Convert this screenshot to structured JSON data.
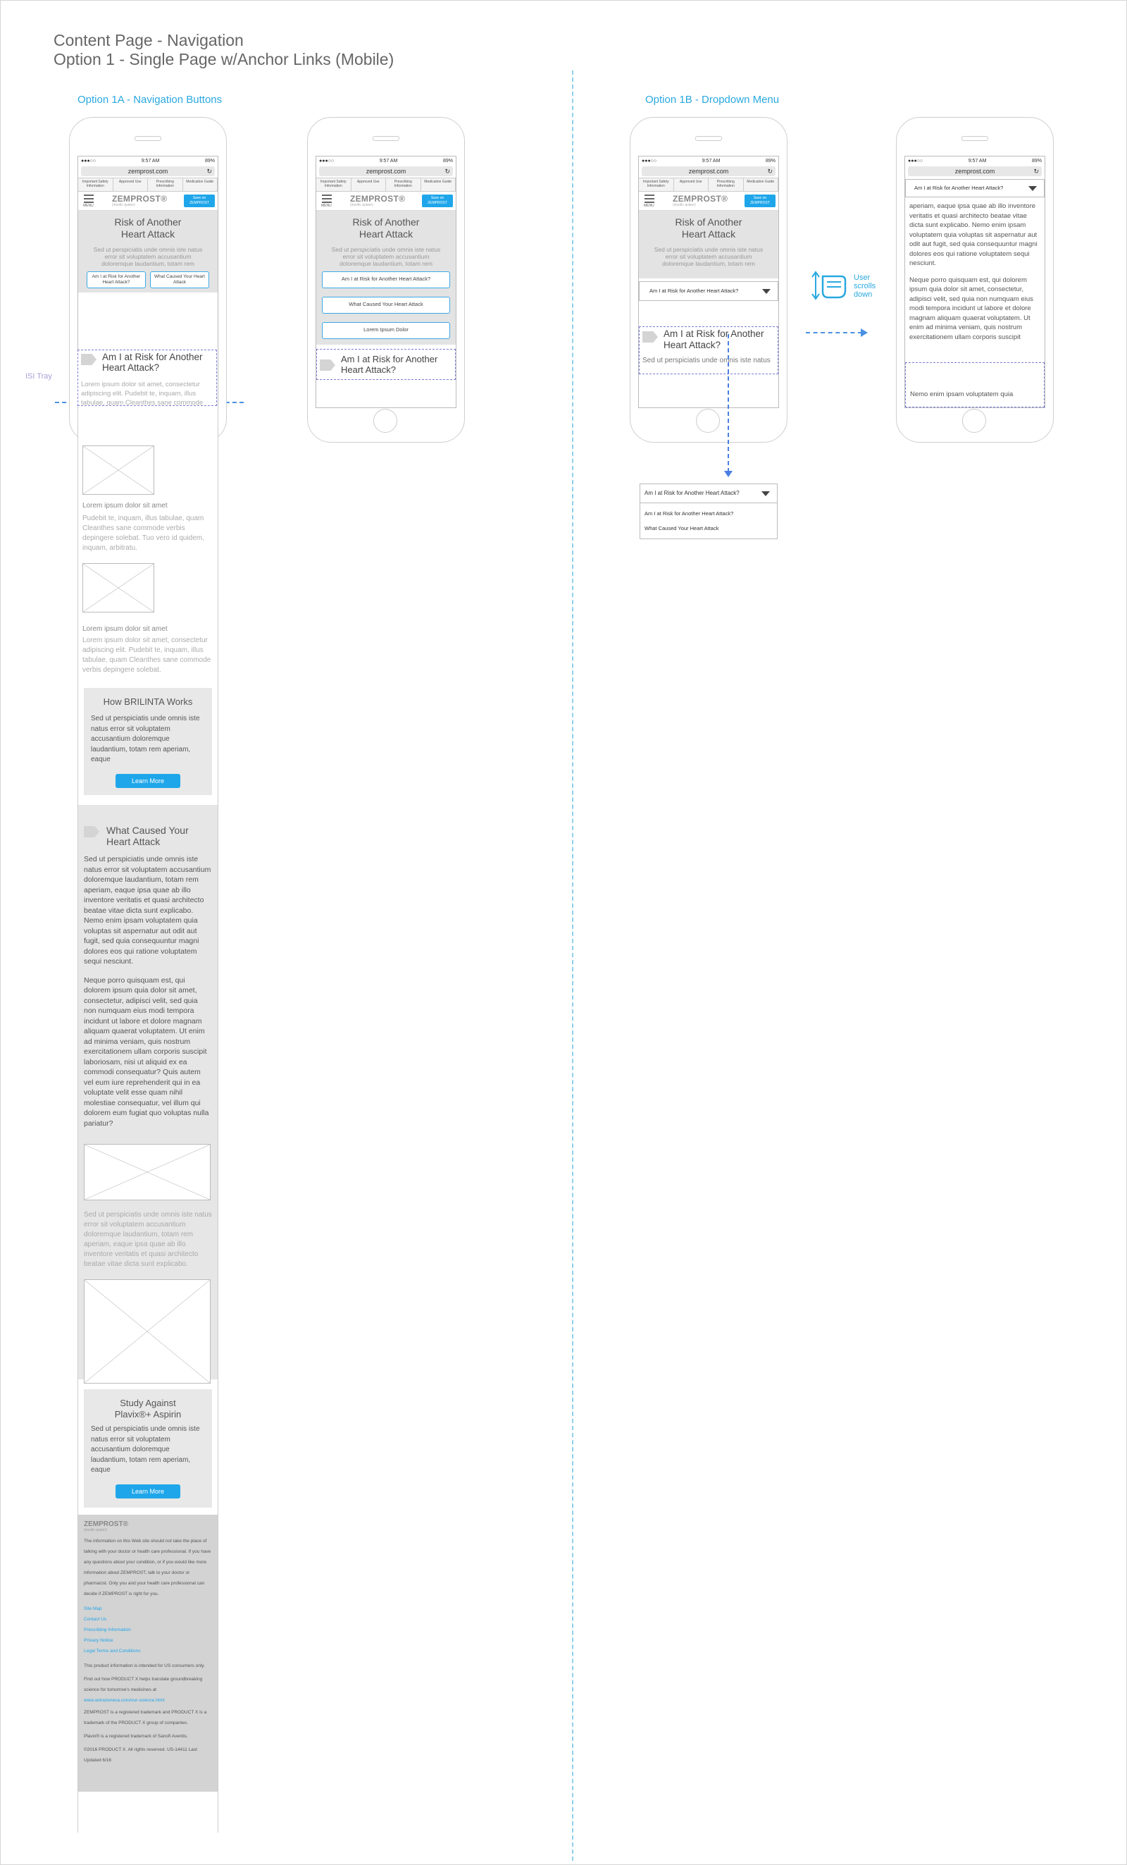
{
  "page": {
    "title_line1": "Content Page - Navigation",
    "title_line2": "Option 1 - Single Page w/Anchor Links (Mobile)",
    "option_1a": "Option 1A - Navigation Buttons",
    "option_1b": "Option 1B - Dropdown Menu",
    "isi_tray_label": "ISI Tray",
    "user_scrolls_label": "User scrolls down"
  },
  "phone": {
    "time": "9:57 AM",
    "battery": "89%",
    "signal": "●●●○○",
    "url": "zemprost.com",
    "reload_icon": "↻",
    "top_links": [
      "Important Safety Information",
      "Approved Use",
      "Prescribing Information",
      "Medication Guide"
    ],
    "menu_label": "MENU",
    "logo": "ZEMPROST®",
    "logo_sub": "(insofic qulaor)",
    "save_button": "Save on ZEMPROST",
    "hero_title": "Risk of Another Heart Attack",
    "hero_text": "Sed ut perspiciatis unde omnis iste natus error sit voluptatem accusantium doloremque laudantium, totam rem",
    "btn_am_i_at_risk_2line": "Am I at Risk for Another Heart Attack?",
    "btn_what_caused_2line": "What Caused Your Heart Attack",
    "btn_am_i_at_risk": "Am I at Risk for Another Heart Attack?",
    "btn_what_caused": "What Caused Your Heart Attack",
    "btn_lorem": "Lorem Ipsum Dolor",
    "isi_heading": "Am I at Risk for Another Heart Attack?",
    "dropdown_selected": "Am I at Risk for Another Heart Attack?",
    "isi_snippet": "Sed ut perspiciatis unde omnis iste natus"
  },
  "long_page": {
    "intro_text": "Lorem ipsum dolor sit amet, consectetur adipiscing elit. Pudebit te, inquam, illus tabulae, quam Cleanthes sane commode verbis depingere solebat. Tuo vero id quidem, inquam, arbitratu.",
    "caption1": "Lorem ipsum dolor sit amet",
    "text1": "Pudebit te, inquam, illus tabulae, quam Cleanthes sane commode verbis depingere solebat. Tuo vero id quidem, inquam, arbitratu.",
    "caption2": "Lorem ipsum dolor sit amet",
    "text2": "Lorem ipsum dolor sit amet, consectetur adipiscing elit. Pudebit te, inquam, illus tabulae, quam Cleanthes sane commode verbis depingere solebat.",
    "card1_title": "How BRILINTA Works",
    "card1_text": "Sed ut perspiciatis unde omnis iste natus error sit voluptatem accusantium doloremque laudantium, totam rem aperiam, eaque",
    "learn_more": "Learn More",
    "section2_title": "What Caused Your Heart Attack",
    "section2_p1": "Sed ut perspiciatis unde omnis iste natus error sit voluptatem accusantium doloremque laudantium, totam rem aperiam, eaque ipsa quae ab illo inventore veritatis et quasi architecto beatae vitae dicta sunt explicabo. Nemo enim ipsam voluptatem quia voluptas sit aspernatur aut odit aut fugit, sed quia consequuntur magni dolores eos qui ratione voluptatem sequi nesciunt.",
    "section2_p2": "Neque porro quisquam est, qui dolorem ipsum quia dolor sit amet, consectetur, adipisci velit, sed quia non numquam eius modi tempora incidunt ut labore et dolore magnam aliquam quaerat voluptatem. Ut enim ad minima veniam, quis nostrum exercitationem ullam corporis suscipit laboriosam, nisi ut aliquid ex ea commodi consequatur? Quis autem vel eum iure reprehenderit qui in ea voluptate velit esse quam nihil molestiae consequatur, vel illum qui dolorem eum fugiat quo voluptas nulla pariatur?",
    "section2_p3": "Sed ut perspiciatis unde omnis iste natus error sit voluptatem accusantium doloremque laudantium, totam rem aperiam, eaque ipsa quae ab illo inventore veritatis et quasi architecto beatae vitae dicta sunt explicabo.",
    "card2_title_a": "Study Against",
    "card2_title_b": "Plavix®+ Aspirin",
    "card2_text": "Sed ut perspiciatis unde omnis iste natus error sit voluptatem accusantium doloremque laudantium, totam rem aperiam, eaque",
    "footer_logo": "ZEMPROST®",
    "footer_logo_sub": "(insofic qulaor)",
    "footer_disclaimer": "The information on this Web site should not take the place of talking with your doctor or health care professional. If you have any questions about your condition, or if you would like more information about ZEMPROST, talk to your doctor or pharmacist. Only you and your health care professional can decide if ZEMPROST is right for you.",
    "footer_links": [
      "Site Map",
      "Contact Us",
      "Prescribing Information",
      "Privacy Notice",
      "Legal Terms and Conditions"
    ],
    "footer_us": "This product information is intended for US consumers only.",
    "footer_find": "Find out how PRODUCT X helps translate groundbreaking science for tomorrow's medicines at",
    "footer_url": "www.astrazeneca.com/our-science.html",
    "footer_tm1": "ZEMPROST is a registered trademark and PRODUCT X is a trademark of the PRODUCT X group of companies.",
    "footer_tm2": "Plavix® is a registered trademark of Sanofi Aventis.",
    "footer_copy": "©2016 PRODUCT X. All rights reserved. US-14411 Last Updated 6/16"
  },
  "option_b": {
    "scrolled_text_1": "aperiam, eaque ipsa quae ab illo inventore veritatis et quasi architecto beatae vitae dicta sunt explicabo. Nemo enim ipsam voluptatem quia voluptas sit aspernatur aut odit aut fugit, sed quia consequuntur magni dolores eos qui ratione voluptatem sequi nesciunt.",
    "scrolled_text_2": "Neque porro quisquam est, qui dolorem ipsum quia dolor sit amet, consectetur, adipisci velit, sed quia non numquam eius modi tempora incidunt ut labore et dolore magnam aliquam quaerat voluptatem. Ut enim ad minima veniam, quis nostrum exercitationem ullam corporis suscipit",
    "scrolled_text_3": "Nemo enim ipsam voluptatem quia",
    "dropdown_options": [
      "Am I at Risk for Another Heart Attack?",
      "What Caused Your Heart Attack"
    ]
  },
  "colors": {
    "accent": "#29a8e0",
    "button_blue": "#1fa6ea",
    "hero_grey": "#e3e3e3",
    "isi_border": "#7b7bd6"
  }
}
